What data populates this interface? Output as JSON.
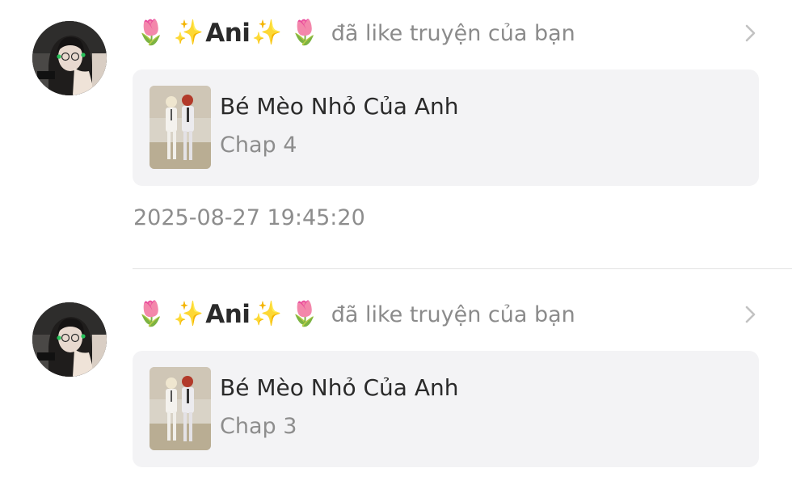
{
  "notifications": [
    {
      "user": {
        "name": "Ani",
        "decor_left": "🌷 ✨",
        "decor_right": "✨ 🌷"
      },
      "action": "đã like truyện của bạn",
      "story": {
        "title": "Bé Mèo Nhỏ Của Anh",
        "chapter": "Chap 4"
      },
      "timestamp": "2025-08-27 19:45:20"
    },
    {
      "user": {
        "name": "Ani",
        "decor_left": "🌷 ✨",
        "decor_right": "✨ 🌷"
      },
      "action": "đã like truyện của bạn",
      "story": {
        "title": "Bé Mèo Nhỏ Của Anh",
        "chapter": "Chap 3"
      }
    }
  ],
  "icons": {
    "open": "chevron-right-icon",
    "avatar": "user-avatar",
    "cover": "story-cover-image"
  },
  "colors": {
    "card_background": "#f3f3f5",
    "secondary_text": "#8d8d8d",
    "primary_text": "#2a2a2a",
    "divider": "#e2e2e2"
  }
}
